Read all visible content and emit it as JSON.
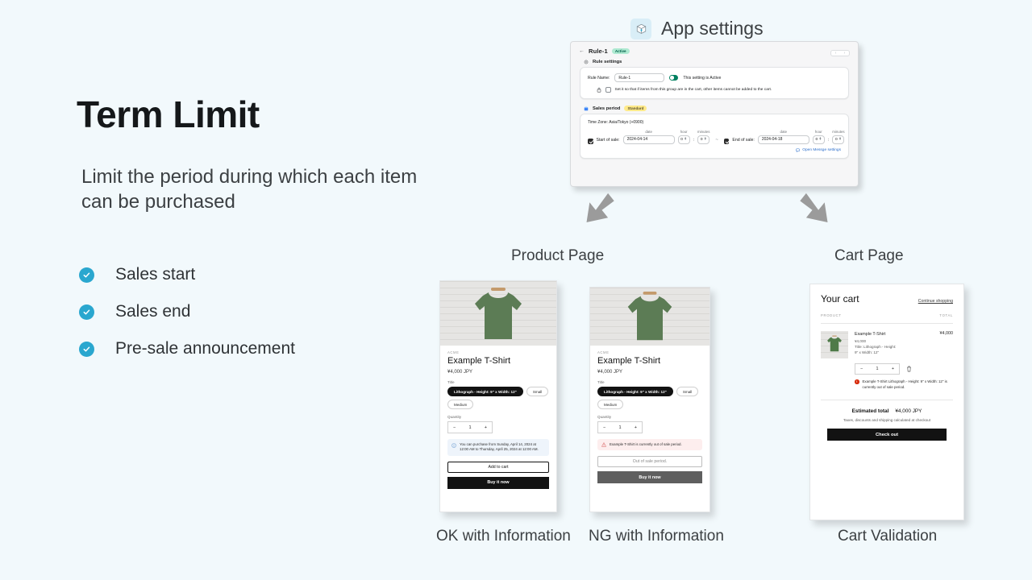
{
  "slide": {
    "background": "#f2f9fc",
    "title": "Term Limit",
    "subtitle": "Limit the period during which each item can be purchased",
    "bullets": [
      {
        "label": "Sales start",
        "icon": "check-circle-icon"
      },
      {
        "label": "Sales end",
        "icon": "check-circle-icon"
      },
      {
        "label": "Pre-sale announcement",
        "icon": "check-circle-icon"
      }
    ],
    "accent": "#2aa7cf"
  },
  "app_settings_header": {
    "icon": "box-icon",
    "label": "App settings"
  },
  "admin_panel": {
    "back_icon": "arrow-left-icon",
    "rule_title": "Rule-1",
    "status_badge": "Active",
    "pager": {
      "prev": "‹",
      "next": "›"
    },
    "rule_settings": {
      "icon": "gear-icon",
      "heading": "Rule settings",
      "rule_name_label": "Rule Name:",
      "rule_name_value": "Rule-1",
      "toggle_state": "on",
      "toggle_text": "This setting is Active",
      "lock_icon": "lock-icon",
      "checkbox_checked": false,
      "checkbox_text": "Set it so that if items from this group are in the cart, other items cannot be added to the cart."
    },
    "sales_period": {
      "icon": "calendar-icon",
      "heading": "Sales period",
      "badge": "Standard",
      "timezone": "Time Zone:  Asia/Tokyo  (+0900)",
      "col_date": "date",
      "col_hour": "hour",
      "col_minutes": "minutes",
      "start_checked": true,
      "start_label": "Start of sale:",
      "start_date": "2024-04-14",
      "start_hour": "0",
      "start_minutes": "0",
      "separator": "~",
      "end_checked": true,
      "end_label": "End of sale:",
      "end_date": "2024-04-18",
      "end_hour": "0",
      "end_minutes": "0",
      "message_link": "Open Messge settings",
      "message_link_icon": "message-icon"
    }
  },
  "arrows": [
    {
      "name": "arrow-to-product-page",
      "direction": "down-left",
      "color": "#9b9b9b"
    },
    {
      "name": "arrow-to-cart-page",
      "direction": "down-right",
      "color": "#9b9b9b"
    }
  ],
  "section_captions": {
    "product_page": "Product Page",
    "cart_page": "Cart Page"
  },
  "product_cards": [
    {
      "caption": "OK with Information",
      "vendor": "ACME",
      "name": "Example T-Shirt",
      "price": "¥4,000 JPY",
      "variant_label": "Title",
      "variants": [
        {
          "label": "Lithograph - Height: 9\" x Width: 12\"",
          "selected": true
        },
        {
          "label": "Small",
          "selected": false
        },
        {
          "label": "Medium",
          "selected": false
        }
      ],
      "quantity_label": "Quantity",
      "quantity_minus": "−",
      "quantity_value": "1",
      "quantity_plus": "+",
      "notice_type": "info",
      "notice_icon": "info-icon",
      "notice_text": "You can purchase from Sunday, April 14, 2024 at 12:00 AM to Thursday, April 25, 2024 at 12:00 AM.",
      "primary_button": "Add to cart",
      "secondary_button": "Buy it now",
      "disabled": false
    },
    {
      "caption": "NG with Information",
      "vendor": "ACME",
      "name": "Example T-Shirt",
      "price": "¥4,000 JPY",
      "variant_label": "Title",
      "variants": [
        {
          "label": "Lithograph - Height: 9\" x Width: 12\"",
          "selected": true
        },
        {
          "label": "Small",
          "selected": false
        },
        {
          "label": "Medium",
          "selected": false
        }
      ],
      "quantity_label": "Quantity",
      "quantity_minus": "−",
      "quantity_value": "1",
      "quantity_plus": "+",
      "notice_type": "warning",
      "notice_icon": "warning-icon",
      "notice_text": "Example T-Shirt is currently out of sale period.",
      "primary_button": "Out of sale period.",
      "secondary_button": "Buy it now",
      "disabled": true
    }
  ],
  "cart_card": {
    "caption": "Cart Validation",
    "title": "Your cart",
    "continue_shopping": "Continue shopping",
    "col_product": "PRODUCT",
    "col_total": "TOTAL",
    "item": {
      "name": "Example T-Shirt",
      "price": "¥4,000",
      "option_line1": "Title: Lithograph - Height:",
      "option_line2": "9\" x Width: 12\"",
      "line_total": "¥4,000",
      "qty_minus": "−",
      "qty_value": "1",
      "qty_plus": "+",
      "remove_icon": "trash-icon",
      "error_icon": "error-icon",
      "error_text": "Example T-Shirt Lithograph - Height: 9\" x Width: 12\" is currently out of sale period."
    },
    "estimated_total_label": "Estimated total",
    "estimated_total_value": "¥4,000 JPY",
    "tax_note": "Taxes, discounts and shipping calculated at checkout",
    "checkout_button": "Check out"
  }
}
